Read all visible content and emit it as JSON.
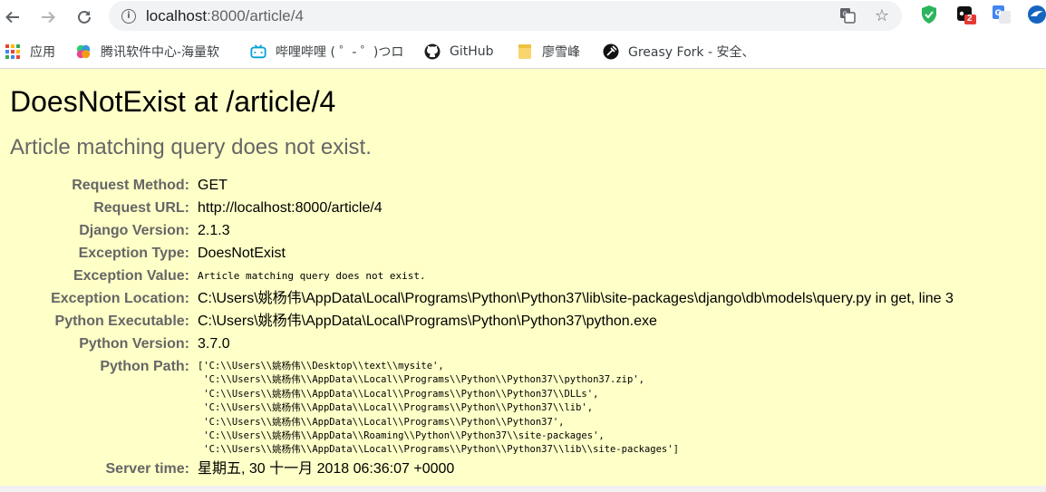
{
  "browser": {
    "url_host": "localhost",
    "url_path": ":8000/article/4",
    "extension_badge": "2"
  },
  "bookmarks": [
    {
      "label": "应用",
      "icon": "apps-grid-icon"
    },
    {
      "label": "腾讯软件中心-海量软",
      "icon": "tencent-software-icon"
    },
    {
      "label": "哔哩哔哩 ( ゜- ゜)つロ",
      "icon": "bilibili-icon"
    },
    {
      "label": "GitHub",
      "icon": "github-icon"
    },
    {
      "label": "廖雪峰",
      "icon": "folder-icon"
    },
    {
      "label": "Greasy Fork - 安全、",
      "icon": "greasyfork-icon"
    }
  ],
  "error": {
    "title": "DoesNotExist at /article/4",
    "subtitle": "Article matching query does not exist."
  },
  "meta": [
    {
      "label": "Request Method:",
      "value": "GET"
    },
    {
      "label": "Request URL:",
      "value": "http://localhost:8000/article/4"
    },
    {
      "label": "Django Version:",
      "value": "2.1.3"
    },
    {
      "label": "Exception Type:",
      "value": "DoesNotExist"
    },
    {
      "label": "Exception Value:",
      "value": "Article matching query does not exist."
    },
    {
      "label": "Exception Location:",
      "value": "C:\\Users\\姚杨伟\\AppData\\Local\\Programs\\Python\\Python37\\lib\\site-packages\\django\\db\\models\\query.py in get, line 3"
    },
    {
      "label": "Python Executable:",
      "value": "C:\\Users\\姚杨伟\\AppData\\Local\\Programs\\Python\\Python37\\python.exe"
    },
    {
      "label": "Python Version:",
      "value": "3.7.0"
    },
    {
      "label": "Python Path:",
      "value": "['C:\\\\Users\\\\姚杨伟\\\\Desktop\\\\text\\\\mysite',\n 'C:\\\\Users\\\\姚杨伟\\\\AppData\\\\Local\\\\Programs\\\\Python\\\\Python37\\\\python37.zip',\n 'C:\\\\Users\\\\姚杨伟\\\\AppData\\\\Local\\\\Programs\\\\Python\\\\Python37\\\\DLLs',\n 'C:\\\\Users\\\\姚杨伟\\\\AppData\\\\Local\\\\Programs\\\\Python\\\\Python37\\\\lib',\n 'C:\\\\Users\\\\姚杨伟\\\\AppData\\\\Local\\\\Programs\\\\Python\\\\Python37',\n 'C:\\\\Users\\\\姚杨伟\\\\AppData\\\\Roaming\\\\Python\\\\Python37\\\\site-packages',\n 'C:\\\\Users\\\\姚杨伟\\\\AppData\\\\Local\\\\Programs\\\\Python\\\\Python37\\\\lib\\\\site-packages']"
    },
    {
      "label": "Server time:",
      "value": "星期五, 30 十一月 2018 06:36:07 +0000"
    }
  ],
  "colors": {
    "page_background": "#ffffc8",
    "label_gray": "#666666"
  }
}
